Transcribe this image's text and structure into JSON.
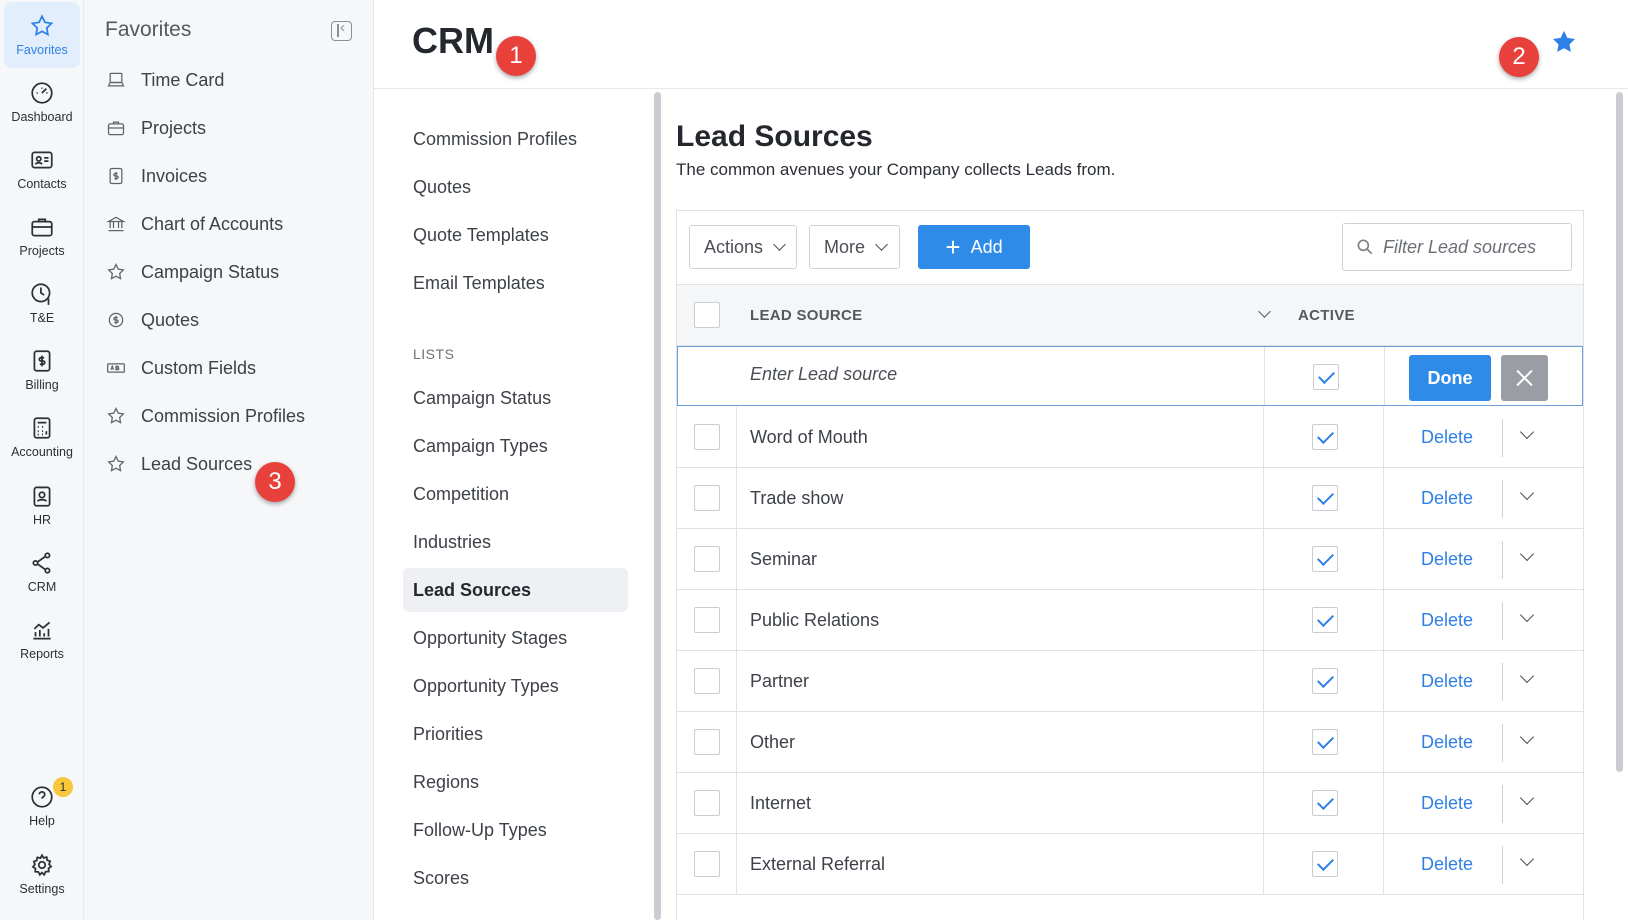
{
  "rail": {
    "items": [
      {
        "label": "Favorites",
        "icon": "star-icon"
      },
      {
        "label": "Dashboard",
        "icon": "gauge-icon"
      },
      {
        "label": "Contacts",
        "icon": "contact-card-icon"
      },
      {
        "label": "Projects",
        "icon": "briefcase-icon"
      },
      {
        "label": "T&E",
        "icon": "clock-dollar-icon"
      },
      {
        "label": "Billing",
        "icon": "invoice-icon"
      },
      {
        "label": "Accounting",
        "icon": "calculator-icon"
      },
      {
        "label": "HR",
        "icon": "badge-icon"
      },
      {
        "label": "CRM",
        "icon": "network-icon"
      },
      {
        "label": "Reports",
        "icon": "chart-icon"
      }
    ],
    "help": {
      "label": "Help",
      "badge": "1"
    },
    "settings": {
      "label": "Settings"
    }
  },
  "favorites": {
    "title": "Favorites",
    "items": [
      {
        "label": "Time Card",
        "icon": "laptop-icon"
      },
      {
        "label": "Projects",
        "icon": "briefcase-icon"
      },
      {
        "label": "Invoices",
        "icon": "invoice-icon"
      },
      {
        "label": "Chart of Accounts",
        "icon": "bank-icon"
      },
      {
        "label": "Campaign Status",
        "icon": "star-icon"
      },
      {
        "label": "Quotes",
        "icon": "dollar-circle-icon"
      },
      {
        "label": "Custom Fields",
        "icon": "ab-field-icon"
      },
      {
        "label": "Commission Profiles",
        "icon": "star-icon"
      },
      {
        "label": "Lead Sources",
        "icon": "star-icon"
      }
    ]
  },
  "header": {
    "title": "CRM"
  },
  "callouts": [
    "1",
    "2",
    "3"
  ],
  "nav": {
    "top_items": [
      "Commission Profiles",
      "Quotes",
      "Quote Templates",
      "Email Templates"
    ],
    "lists_heading": "LISTS",
    "list_items": [
      "Campaign Status",
      "Campaign Types",
      "Competition",
      "Industries",
      "Lead Sources",
      "Opportunity Stages",
      "Opportunity Types",
      "Priorities",
      "Regions",
      "Follow-Up Types",
      "Scores"
    ],
    "active": "Lead Sources"
  },
  "content": {
    "title": "Lead Sources",
    "subtitle": "The common avenues your Company collects Leads from.",
    "toolbar": {
      "actions_label": "Actions",
      "more_label": "More",
      "add_label": "Add",
      "filter_placeholder": "Filter Lead sources"
    },
    "columns": {
      "lead_source": "LEAD SOURCE",
      "active": "ACTIVE"
    },
    "edit_row": {
      "placeholder": "Enter Lead source",
      "active": true,
      "done_label": "Done"
    },
    "delete_label": "Delete",
    "rows": [
      {
        "name": "Word of Mouth",
        "active": true
      },
      {
        "name": "Trade show",
        "active": true
      },
      {
        "name": "Seminar",
        "active": true
      },
      {
        "name": "Public Relations",
        "active": true
      },
      {
        "name": "Partner",
        "active": true
      },
      {
        "name": "Other",
        "active": true
      },
      {
        "name": "Internet",
        "active": true
      },
      {
        "name": "External Referral",
        "active": true
      }
    ]
  },
  "colors": {
    "accent": "#2f80e6",
    "callout": "#e8403a",
    "badge": "#f7c83a"
  }
}
